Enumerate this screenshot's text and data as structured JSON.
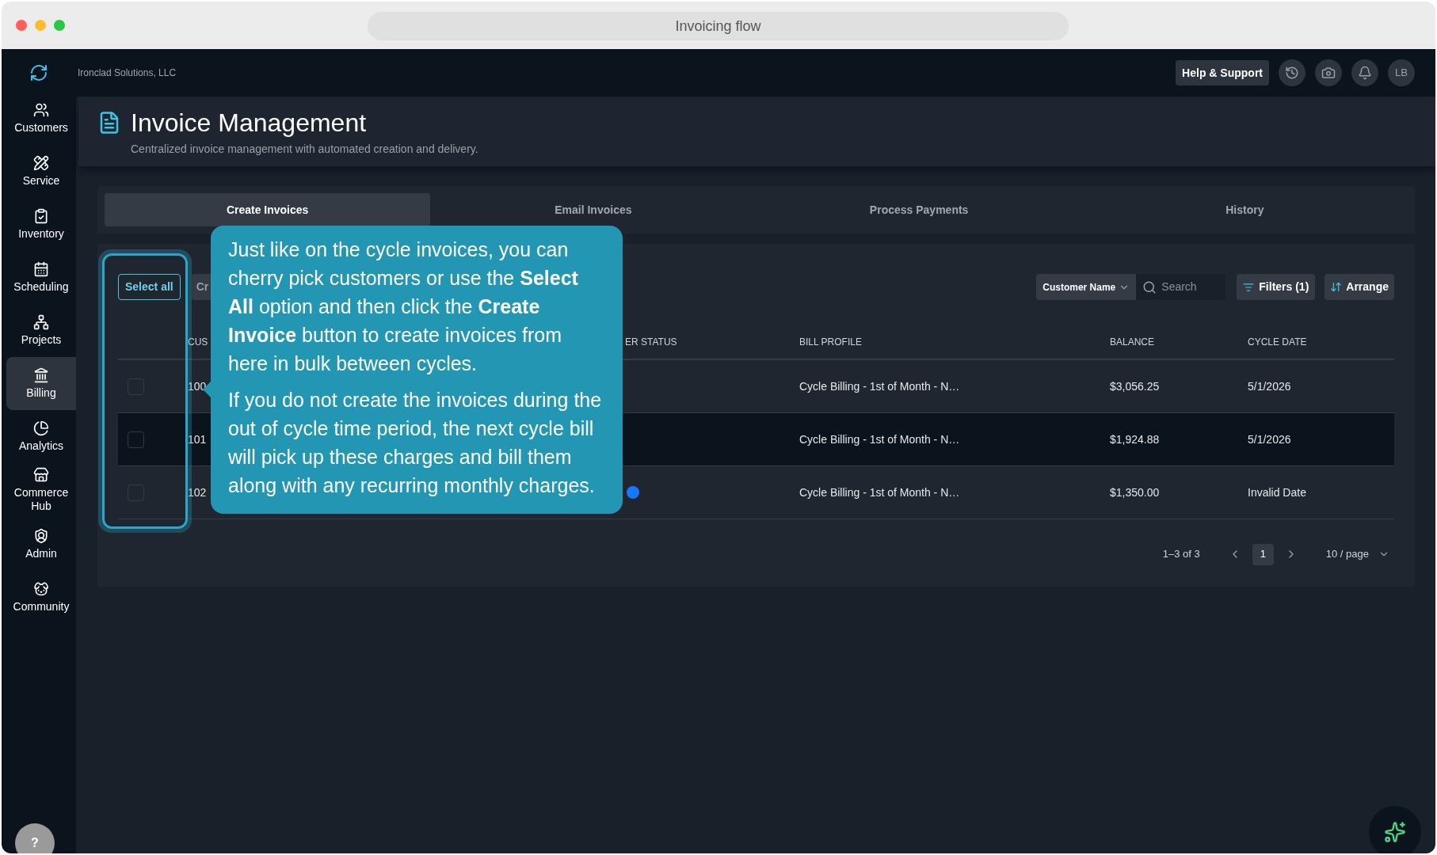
{
  "window": {
    "title": "Invoicing flow"
  },
  "company": "Ironclad Solutions, LLC",
  "header_actions": {
    "help": "Help & Support",
    "avatar": "LB"
  },
  "help_button": "?",
  "sidebar": {
    "items": [
      {
        "label": "Customers",
        "selected": false
      },
      {
        "label": "Service",
        "selected": false
      },
      {
        "label": "Inventory",
        "selected": false
      },
      {
        "label": "Scheduling",
        "selected": false
      },
      {
        "label": "Projects",
        "selected": false
      },
      {
        "label": "Billing",
        "selected": true
      },
      {
        "label": "Analytics",
        "selected": false
      },
      {
        "label": "Commerce Hub",
        "selected": false
      },
      {
        "label": "Admin",
        "selected": false
      },
      {
        "label": "Community",
        "selected": false
      }
    ]
  },
  "page": {
    "title": "Invoice Management",
    "subtitle": "Centralized invoice management with automated creation and delivery."
  },
  "tabs": [
    {
      "label": "Create Invoices",
      "selected": true
    },
    {
      "label": "Email Invoices",
      "selected": false
    },
    {
      "label": "Process Payments",
      "selected": false
    },
    {
      "label": "History",
      "selected": false
    }
  ],
  "toolbar": {
    "select_all": "Select all",
    "create": "Cr",
    "search_by": "Customer Name",
    "search": {
      "placeholder": "Search"
    },
    "filters": "Filters (1)",
    "arrange": "Arrange"
  },
  "table": {
    "columns": [
      "CUS",
      "ER STATUS",
      "BILL PROFILE",
      "BALANCE",
      "CYCLE DATE"
    ],
    "rows": [
      {
        "checked": false,
        "highlighted": false,
        "status_badge": false,
        "customer": "100",
        "bill_profile": "Cycle Billing - 1st of Month - N…",
        "balance": "$3,056.25",
        "cycle_date": "5/1/2026"
      },
      {
        "checked": false,
        "highlighted": true,
        "status_badge": false,
        "customer": "101",
        "bill_profile": "Cycle Billing - 1st of Month - N…",
        "balance": "$1,924.88",
        "cycle_date": "5/1/2026"
      },
      {
        "checked": false,
        "highlighted": false,
        "status_badge": true,
        "customer": "102",
        "bill_profile": "Cycle Billing - 1st of Month - N…",
        "balance": "$1,350.00",
        "cycle_date": "Invalid Date"
      }
    ]
  },
  "pagination": {
    "range": "1–3 of 3",
    "pages": [
      {
        "label": "1",
        "selected": true
      }
    ],
    "page_size": "10 / page"
  },
  "tooltip": {
    "paragraphs": [
      "Just like on the cycle invoices, you can cherry pick customers or use the **Select All** option and then click the **Create Invoice** button to create invoices from here in bulk between cycles.",
      "If you do not create the invoices during the out of cycle time period, the next cycle bill will pick up these charges and bill them along with any recurring monthly charges."
    ]
  }
}
